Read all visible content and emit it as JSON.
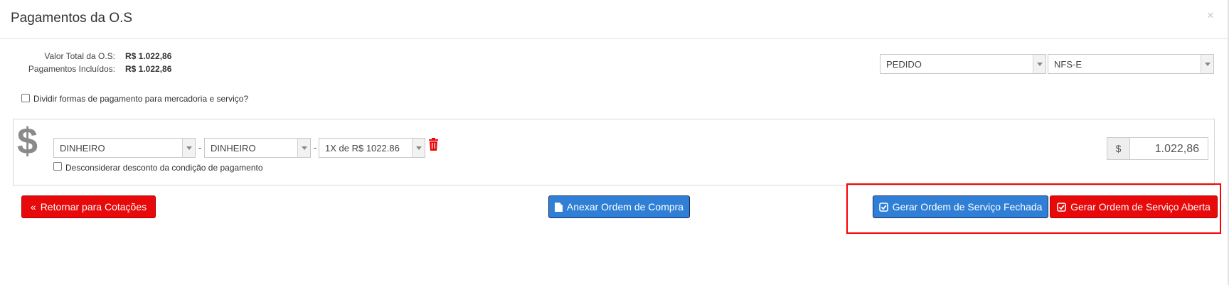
{
  "modal": {
    "title": "Pagamentos da O.S",
    "close_icon": "×"
  },
  "summary": {
    "total_label": "Valor Total da O.S:",
    "total_value": "R$ 1.022,86",
    "paid_label": "Pagamentos Incluídos:",
    "paid_value": "R$ 1.022,86"
  },
  "selects_top": {
    "tipo": "PEDIDO",
    "nota": "NFS-E"
  },
  "split_checkbox": {
    "label": "Dividir formas de pagamento para mercadoria e serviço?",
    "checked": false
  },
  "payment_row": {
    "currency_icon": "$",
    "forma": "DINHEIRO",
    "meio": "DINHEIRO",
    "condicao": "1X de R$ 1022.86",
    "separator": "-",
    "ignore_discount_label": "Desconsiderar desconto da condição de pagamento",
    "ignore_discount_checked": false,
    "amount_prefix": "$",
    "amount": "1.022,86"
  },
  "buttons": {
    "back": "Retornar para Cotações",
    "attach": "Anexar Ordem de Compra",
    "closed_os": "Gerar Ordem de Serviço Fechada",
    "open_os": "Gerar Ordem de Serviço Aberta"
  },
  "colors": {
    "red": "#e8090a",
    "blue": "#2f7fd6",
    "highlight": "#ff0000"
  }
}
